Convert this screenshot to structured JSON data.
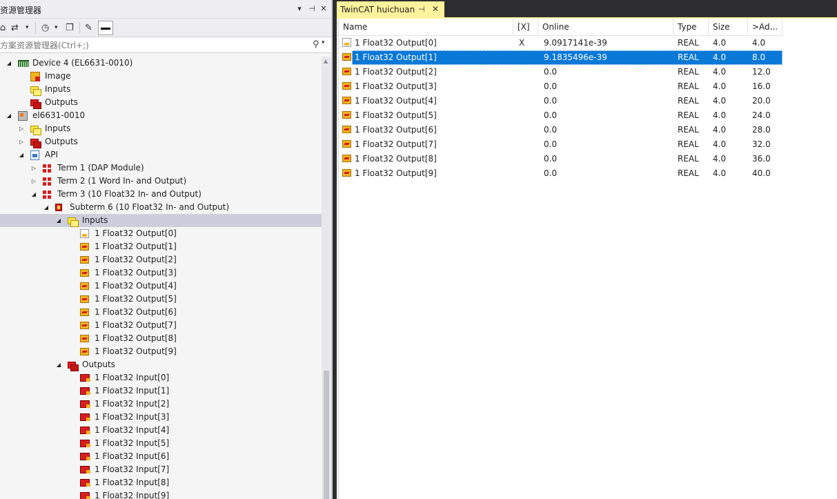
{
  "left_panel": {
    "title": "资源管理器",
    "search_placeholder": "方案资源管理器(Ctrl+;)",
    "title_buttons": {
      "dropdown": "▾",
      "pin": "⊣",
      "close": "✕"
    },
    "toolbar": {
      "home": "⌂",
      "sync": "⇄",
      "history": "◷",
      "pages": "❐",
      "wrench": "✎"
    },
    "tree": [
      {
        "label": "Device 4 (EL6631-0010)",
        "level": 0,
        "expanded": true,
        "icon": "device-icon"
      },
      {
        "label": "Image",
        "level": 1,
        "icon": "image-icon"
      },
      {
        "label": "Inputs",
        "level": 1,
        "icon": "inputs-icon"
      },
      {
        "label": "Outputs",
        "level": 1,
        "icon": "outputs-icon"
      },
      {
        "label": "el6631-0010",
        "level": 0,
        "expanded": true,
        "icon": "box-icon"
      },
      {
        "label": "Inputs",
        "level": 1,
        "expanded": false,
        "icon": "inputs-icon"
      },
      {
        "label": "Outputs",
        "level": 1,
        "expanded": false,
        "icon": "outputs-icon"
      },
      {
        "label": "API",
        "level": 1,
        "expanded": true,
        "icon": "api-icon"
      },
      {
        "label": "Term 1 (DAP Module)",
        "level": 2,
        "expanded": false,
        "icon": "term-icon"
      },
      {
        "label": "Term 2 (1 Word In- and Output)",
        "level": 2,
        "expanded": false,
        "icon": "term-icon"
      },
      {
        "label": "Term 3 (10 Float32 In- and Output)",
        "level": 2,
        "expanded": true,
        "icon": "term-icon"
      },
      {
        "label": "Subterm 6 (10 Float32 In- and Output)",
        "level": 3,
        "expanded": true,
        "icon": "subterm-icon"
      },
      {
        "label": "Inputs",
        "level": 4,
        "expanded": true,
        "icon": "inputs-icon",
        "selected": true
      },
      {
        "label": "1 Float32 Output[0]",
        "level": 5,
        "icon": "linked-variable-icon"
      },
      {
        "label": "1 Float32 Output[1]",
        "level": 5,
        "icon": "input-variable-icon"
      },
      {
        "label": "1 Float32 Output[2]",
        "level": 5,
        "icon": "input-variable-icon"
      },
      {
        "label": "1 Float32 Output[3]",
        "level": 5,
        "icon": "input-variable-icon"
      },
      {
        "label": "1 Float32 Output[4]",
        "level": 5,
        "icon": "input-variable-icon"
      },
      {
        "label": "1 Float32 Output[5]",
        "level": 5,
        "icon": "input-variable-icon"
      },
      {
        "label": "1 Float32 Output[6]",
        "level": 5,
        "icon": "input-variable-icon"
      },
      {
        "label": "1 Float32 Output[7]",
        "level": 5,
        "icon": "input-variable-icon"
      },
      {
        "label": "1 Float32 Output[8]",
        "level": 5,
        "icon": "input-variable-icon"
      },
      {
        "label": "1 Float32 Output[9]",
        "level": 5,
        "icon": "input-variable-icon"
      },
      {
        "label": "Outputs",
        "level": 4,
        "expanded": true,
        "icon": "outputs-icon"
      },
      {
        "label": "1 Float32 Input[0]",
        "level": 5,
        "icon": "output-variable-icon"
      },
      {
        "label": "1 Float32 Input[1]",
        "level": 5,
        "icon": "output-variable-icon"
      },
      {
        "label": "1 Float32 Input[2]",
        "level": 5,
        "icon": "output-variable-icon"
      },
      {
        "label": "1 Float32 Input[3]",
        "level": 5,
        "icon": "output-variable-icon"
      },
      {
        "label": "1 Float32 Input[4]",
        "level": 5,
        "icon": "output-variable-icon"
      },
      {
        "label": "1 Float32 Input[5]",
        "level": 5,
        "icon": "output-variable-icon"
      },
      {
        "label": "1 Float32 Input[6]",
        "level": 5,
        "icon": "output-variable-icon"
      },
      {
        "label": "1 Float32 Input[7]",
        "level": 5,
        "icon": "output-variable-icon"
      },
      {
        "label": "1 Float32 Input[8]",
        "level": 5,
        "icon": "output-variable-icon"
      },
      {
        "label": "1 Float32 Input[9]",
        "level": 5,
        "icon": "output-variable-icon"
      }
    ]
  },
  "right_panel": {
    "tab": {
      "title": "TwinCAT huichuan",
      "pin": "⊣",
      "close": "✕"
    },
    "columns": [
      "Name",
      "[X]",
      "Online",
      "Type",
      "Size",
      ">Ad..."
    ],
    "rows": [
      {
        "name": "1 Float32 Output[0]",
        "x": "X",
        "online": "9.0917141e-39",
        "type": "REAL",
        "size": "4.0",
        "addr": "4.0",
        "icon": "linked-variable-icon"
      },
      {
        "name": "1 Float32 Output[1]",
        "x": "",
        "online": "9.1835496e-39",
        "type": "REAL",
        "size": "4.0",
        "addr": "8.0",
        "icon": "input-variable-icon",
        "selected": true
      },
      {
        "name": "1 Float32 Output[2]",
        "x": "",
        "online": "0.0",
        "type": "REAL",
        "size": "4.0",
        "addr": "12.0",
        "icon": "input-variable-icon"
      },
      {
        "name": "1 Float32 Output[3]",
        "x": "",
        "online": "0.0",
        "type": "REAL",
        "size": "4.0",
        "addr": "16.0",
        "icon": "input-variable-icon"
      },
      {
        "name": "1 Float32 Output[4]",
        "x": "",
        "online": "0.0",
        "type": "REAL",
        "size": "4.0",
        "addr": "20.0",
        "icon": "input-variable-icon"
      },
      {
        "name": "1 Float32 Output[5]",
        "x": "",
        "online": "0.0",
        "type": "REAL",
        "size": "4.0",
        "addr": "24.0",
        "icon": "input-variable-icon"
      },
      {
        "name": "1 Float32 Output[6]",
        "x": "",
        "online": "0.0",
        "type": "REAL",
        "size": "4.0",
        "addr": "28.0",
        "icon": "input-variable-icon"
      },
      {
        "name": "1 Float32 Output[7]",
        "x": "",
        "online": "0.0",
        "type": "REAL",
        "size": "4.0",
        "addr": "32.0",
        "icon": "input-variable-icon"
      },
      {
        "name": "1 Float32 Output[8]",
        "x": "",
        "online": "0.0",
        "type": "REAL",
        "size": "4.0",
        "addr": "36.0",
        "icon": "input-variable-icon"
      },
      {
        "name": "1 Float32 Output[9]",
        "x": "",
        "online": "0.0",
        "type": "REAL",
        "size": "4.0",
        "addr": "40.0",
        "icon": "input-variable-icon"
      }
    ]
  },
  "colors": {
    "selection": "#0a78d7",
    "tree_selection": "#cccedb",
    "tab_active": "#fff29d",
    "chrome_dark": "#2d2d30"
  }
}
